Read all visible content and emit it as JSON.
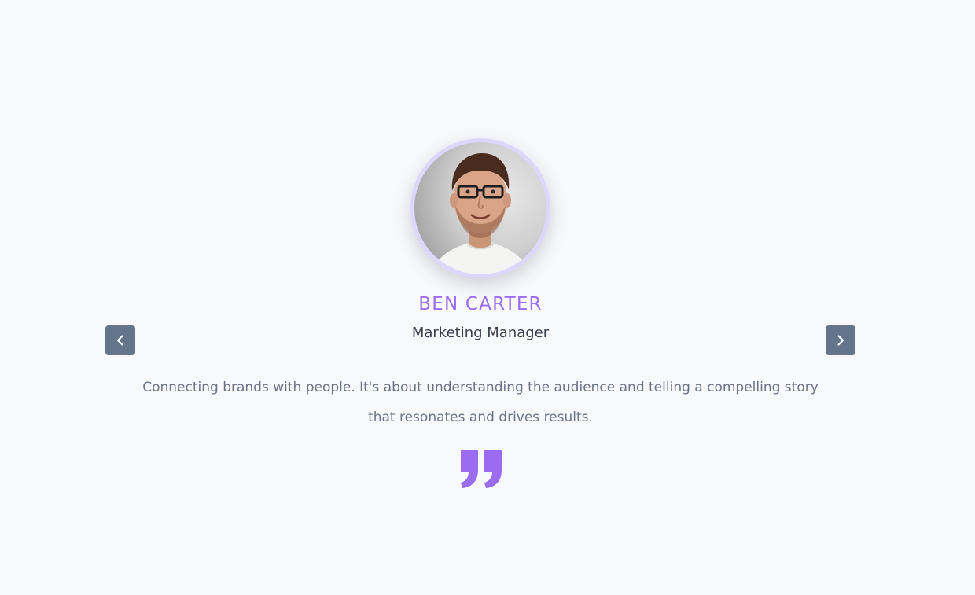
{
  "testimonial": {
    "name": "BEN CARTER",
    "role": "Marketing Manager",
    "quote": "Connecting brands with people. It's about understanding the audience and telling a compelling story that resonates and drives results."
  },
  "navigation": {
    "prev_icon": "chevron-left-icon",
    "next_icon": "chevron-right-icon"
  },
  "icons": {
    "quote": "closing-quote-icon"
  },
  "colors": {
    "accent": "#9c6cf0",
    "avatar_ring": "#ddd6fe",
    "nav_button": "#64748b",
    "background": "#f8f9fb",
    "quote_text": "#6b7385",
    "role_text": "#3a3f4b"
  }
}
